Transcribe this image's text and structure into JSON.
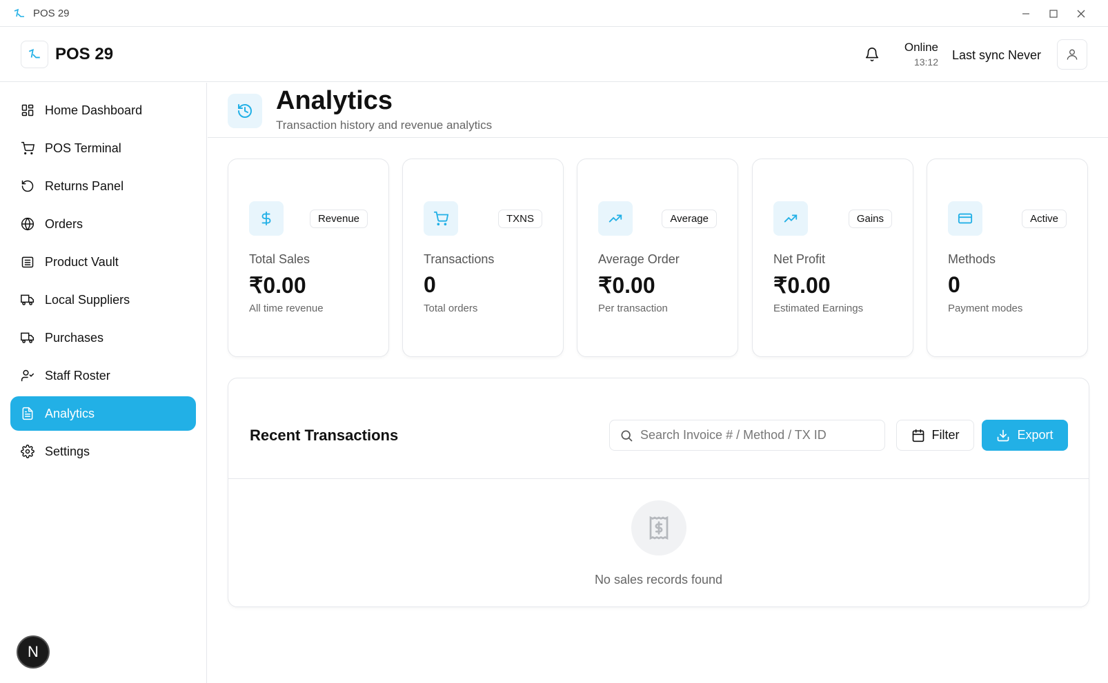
{
  "window": {
    "title": "POS 29"
  },
  "header": {
    "brand": "POS 29",
    "status": "Online",
    "time": "13:12",
    "sync": "Last sync Never"
  },
  "sidebar": {
    "items": [
      {
        "label": "Home Dashboard",
        "icon": "grid-icon"
      },
      {
        "label": "POS Terminal",
        "icon": "cart-icon"
      },
      {
        "label": "Returns Panel",
        "icon": "undo-icon"
      },
      {
        "label": "Orders",
        "icon": "globe-icon"
      },
      {
        "label": "Product Vault",
        "icon": "vault-icon"
      },
      {
        "label": "Local Suppliers",
        "icon": "truck-icon"
      },
      {
        "label": "Purchases",
        "icon": "truck-icon"
      },
      {
        "label": "Staff Roster",
        "icon": "user-check-icon"
      },
      {
        "label": "Analytics",
        "icon": "document-icon",
        "active": true
      },
      {
        "label": "Settings",
        "icon": "gear-icon"
      }
    ],
    "badge": "N"
  },
  "page": {
    "title": "Analytics",
    "subtitle": "Transaction history and revenue analytics"
  },
  "cards": [
    {
      "badge": "Revenue",
      "label": "Total Sales",
      "value": "₹0.00",
      "note": "All time revenue",
      "icon": "dollar-icon"
    },
    {
      "badge": "TXNS",
      "label": "Transactions",
      "value": "0",
      "note": "Total orders",
      "icon": "cart-icon"
    },
    {
      "badge": "Average",
      "label": "Average Order",
      "value": "₹0.00",
      "note": "Per transaction",
      "icon": "trend-up-icon"
    },
    {
      "badge": "Gains",
      "label": "Net Profit",
      "value": "₹0.00",
      "note": "Estimated Earnings",
      "icon": "trend-up-icon"
    },
    {
      "badge": "Active",
      "label": "Methods",
      "value": "0",
      "note": "Payment modes",
      "icon": "card-icon"
    }
  ],
  "transactions": {
    "title": "Recent Transactions",
    "search_placeholder": "Search Invoice # / Method / TX ID",
    "filter_label": "Filter",
    "export_label": "Export",
    "empty_text": "No sales records found"
  },
  "colors": {
    "accent": "#22b0e6",
    "accent_light": "#e8f5fc"
  }
}
